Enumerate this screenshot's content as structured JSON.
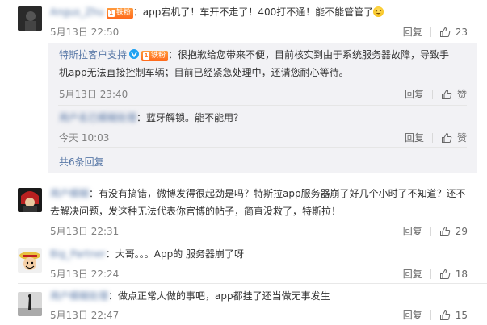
{
  "comments": [
    {
      "username": "Angus_Zhu",
      "fan_badge": "铁粉",
      "text": "：app宕机了！车开不走了！400打不通！能不能管管了",
      "time": "5月13日 22:50",
      "reply_label": "回复",
      "likes": "23",
      "replies": [
        {
          "username": "特斯拉客户支持",
          "fan_badge": "铁粉",
          "text_line1": "：很抱歉给您带来不便，目前核实到由于系统服务器故障，导致手",
          "text_line2": "机app无法直接控制车辆；目前已经紧急处理中，还请您耐心等待。",
          "time": "5月13日 23:40",
          "reply_label": "回复",
          "likes": "赞"
        },
        {
          "username": "用户名已模糊处理",
          "text": "：蓝牙解锁。能不能用？",
          "time": "今天 10:03",
          "reply_label": "回复",
          "likes": "赞"
        }
      ],
      "more_replies": "共6条回复"
    },
    {
      "username": "用户模糊",
      "text_line1": "：有没有搞错，微博发得很起劲是吗？特斯拉app服务器崩了好几个小时了不知道？还不",
      "text_line2": "去解决问题，发这种无法代表你官博的帖子，简直没救了，特斯拉！",
      "time": "5月13日 22:31",
      "reply_label": "回复",
      "likes": "29"
    },
    {
      "username": "Big_Partner",
      "text": "：大哥。。。App的 服务器崩了呀",
      "time": "5月13日 22:24",
      "reply_label": "回复",
      "likes": "18"
    },
    {
      "username": "用户模糊处理",
      "text": "：做点正常人做的事吧，app都挂了还当做无事发生",
      "time": "5月13日 22:47",
      "reply_label": "回复",
      "likes": "15"
    }
  ],
  "icons": {
    "like": "thumbs-up-icon",
    "verified": "verified-v-icon",
    "emoji": "laughing-emoji-icon"
  },
  "colors": {
    "link": "#5b7aa8",
    "orange_name": "#eb7350",
    "reply_bg": "#f2f2f5"
  }
}
